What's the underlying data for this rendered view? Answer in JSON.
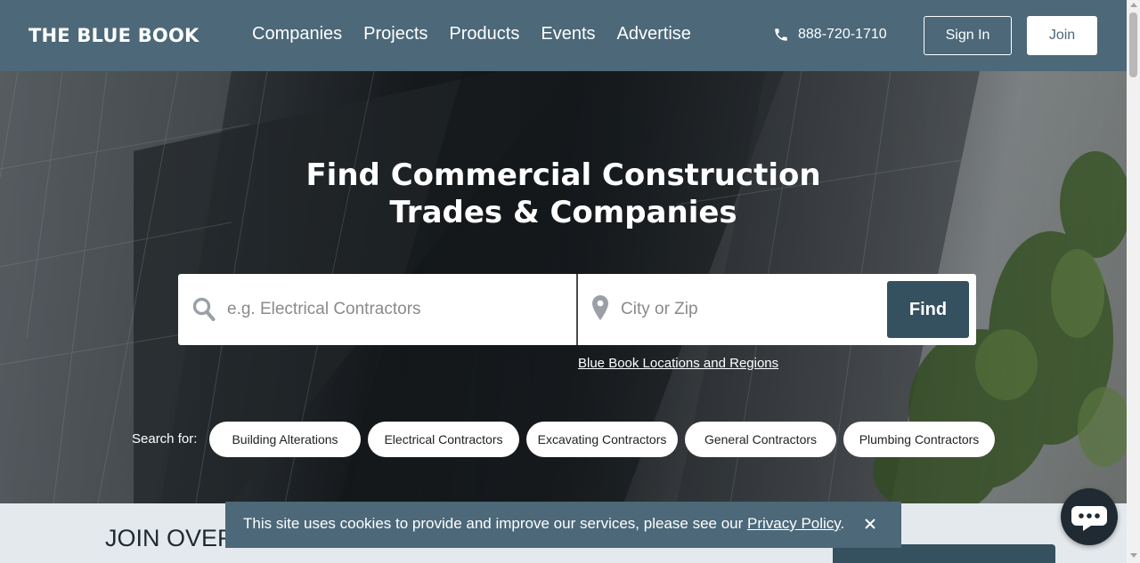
{
  "header": {
    "logo": "THE BLUE BOOK",
    "nav": [
      "Companies",
      "Projects",
      "Products",
      "Events",
      "Advertise"
    ],
    "phone": "888-720-1710",
    "sign_in": "Sign In",
    "join": "Join"
  },
  "hero": {
    "title_line1": "Find Commercial Construction",
    "title_line2": "Trades & Companies",
    "search_placeholder": "e.g. Electrical Contractors",
    "location_placeholder": "City or Zip",
    "find_label": "Find",
    "locations_link": "Blue Book Locations and Regions",
    "search_for_label": "Search for:",
    "chips": [
      "Building Alterations",
      "Electrical Contractors",
      "Excavating Contractors",
      "General Contractors",
      "Plumbing Contractors"
    ]
  },
  "lower": {
    "join_text": "JOIN OVER"
  },
  "cookie": {
    "text": "This site uses cookies to provide and improve our services, please see our ",
    "link": "Privacy Policy",
    "suffix": "."
  },
  "colors": {
    "header": "#4c6879",
    "find_button": "#35505f",
    "chat": "#1f2a33"
  }
}
